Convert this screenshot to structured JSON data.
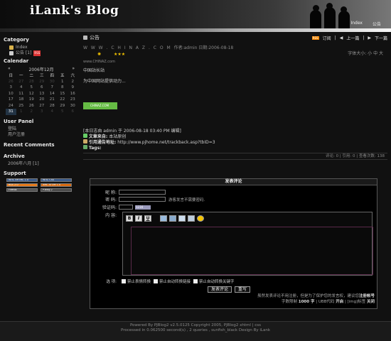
{
  "header": {
    "title": "iLank's Blog",
    "nav": [
      "Index",
      "公告"
    ]
  },
  "sidebar": {
    "category_title": "Category",
    "categories": [
      {
        "label": "Index",
        "icon": "home-icon"
      },
      {
        "label": "公告 [1]",
        "icon": "folder-icon",
        "badge": "RSS"
      }
    ],
    "calendar_title": "Calendar",
    "calendar": {
      "prev": "«",
      "next": "»",
      "month": "2006年12月",
      "weekdays": [
        "日",
        "一",
        "二",
        "三",
        "四",
        "五",
        "六"
      ],
      "weeks": [
        [
          "26",
          "27",
          "28",
          "29",
          "30",
          "1",
          "2"
        ],
        [
          "3",
          "4",
          "5",
          "6",
          "7",
          "8",
          "9"
        ],
        [
          "10",
          "11",
          "12",
          "13",
          "14",
          "15",
          "16"
        ],
        [
          "17",
          "18",
          "19",
          "20",
          "21",
          "22",
          "23"
        ],
        [
          "24",
          "25",
          "26",
          "27",
          "28",
          "29",
          "30"
        ],
        [
          "31",
          "1",
          "2",
          "3",
          "4",
          "5",
          "6"
        ]
      ]
    },
    "user_panel_title": "User Panel",
    "user_links": [
      "登陆",
      "用户注册"
    ],
    "recent_comments_title": "Recent Comments",
    "archive_title": "Archive",
    "archive_items": [
      "2006年八月 [1]"
    ],
    "support_title": "Support",
    "support_badges": [
      "W3C XHTML 1.0",
      "W3C CSS",
      "RSS 2.0",
      "XML ATOM 1.0",
      "Firefox",
      "P.Blog 2"
    ]
  },
  "post": {
    "title": "公告",
    "rss": "RSS",
    "subscribe": "订阅",
    "prev": "上一篇",
    "next": "下一篇",
    "site": "W W W . C H I N A Z . C O M",
    "meta": "作者:admin 日期:2006-08-18",
    "stars": "★★★",
    "font_size": "字体大小: 小 中 大",
    "source_url": "www.CHINAZ.com",
    "body": [
      "中国站长站",
      "为中国网站提供动力..."
    ],
    "image_label": "CHINAZ.COM",
    "edit_note": "[本日志由 admin 于 2006-08-18 03:40 PM 编辑]",
    "from_label": "文章来自:",
    "from_value": "本站原创",
    "trackback_label": "引用通告地址:",
    "trackback_value": "http://www.pjhome.net/trackback.asp?tbID=3",
    "tags_label": "Tags:",
    "stats": "评论: 0 | 引用: 0 | 查看次数: 138"
  },
  "comment_form": {
    "title": "发表评论",
    "nickname_label": "昵  称:",
    "password_label": "密  码:",
    "password_hint": "游客发言不需要密码.",
    "captcha_label": "验证码:",
    "captcha_value": "1234",
    "content_label": "内  容:",
    "toolbar": [
      "B",
      "I",
      "U"
    ],
    "options_label": "选  项:",
    "options": [
      "禁止表情转换",
      "禁止自动转换链接",
      "禁止自动转换关键字"
    ],
    "submit": "发表评论",
    "reset": "重写",
    "note1": "虽然发表评论不用注册，但是为了保护您的发言权，建议您",
    "note1_link": "注册帐号",
    "note2_prefix": "字数限制",
    "note2_value": "1000 字",
    "note2_mid": "| UBB代码",
    "note2_ubb": "开启",
    "note2_img": "| [img]标签",
    "note2_img_state": "关闭"
  },
  "footer": {
    "line1": "Powered By PJBlog2 v2.5.0125 Copyright 2005, PJBlog2 xhtml | css",
    "line2": "Processed in 0.062500 second(s) , 2 queries , sunfish_black Design By iLank"
  }
}
